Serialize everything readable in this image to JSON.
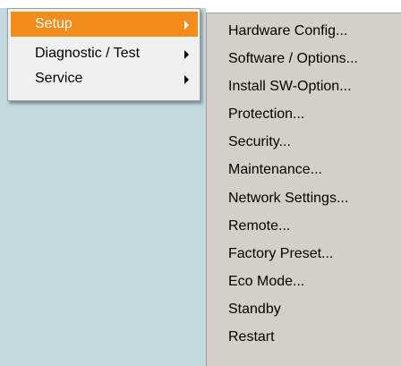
{
  "primary_menu": {
    "items": [
      {
        "label": "Setup",
        "selected": true,
        "has_submenu": true
      },
      {
        "label": "Diagnostic / Test",
        "selected": false,
        "has_submenu": true
      },
      {
        "label": "Service",
        "selected": false,
        "has_submenu": true
      }
    ],
    "highlight_color": "#f28c1b"
  },
  "submenu": {
    "items": [
      {
        "label": "Hardware Config..."
      },
      {
        "label": "Software / Options..."
      },
      {
        "label": "Install SW-Option..."
      },
      {
        "label": "Protection..."
      },
      {
        "label": "Security..."
      },
      {
        "label": "Maintenance..."
      },
      {
        "label": "Network Settings..."
      },
      {
        "label": "Remote..."
      },
      {
        "label": "Factory Preset..."
      },
      {
        "label": "Eco Mode..."
      },
      {
        "label": "Standby"
      },
      {
        "label": "Restart"
      }
    ]
  },
  "icons": {
    "submenu_arrow": "chevron-right-icon"
  },
  "colors": {
    "desktop_background": "#c3d9df",
    "menu_background": "#f0f0f0",
    "submenu_background": "#d4d0c8"
  }
}
